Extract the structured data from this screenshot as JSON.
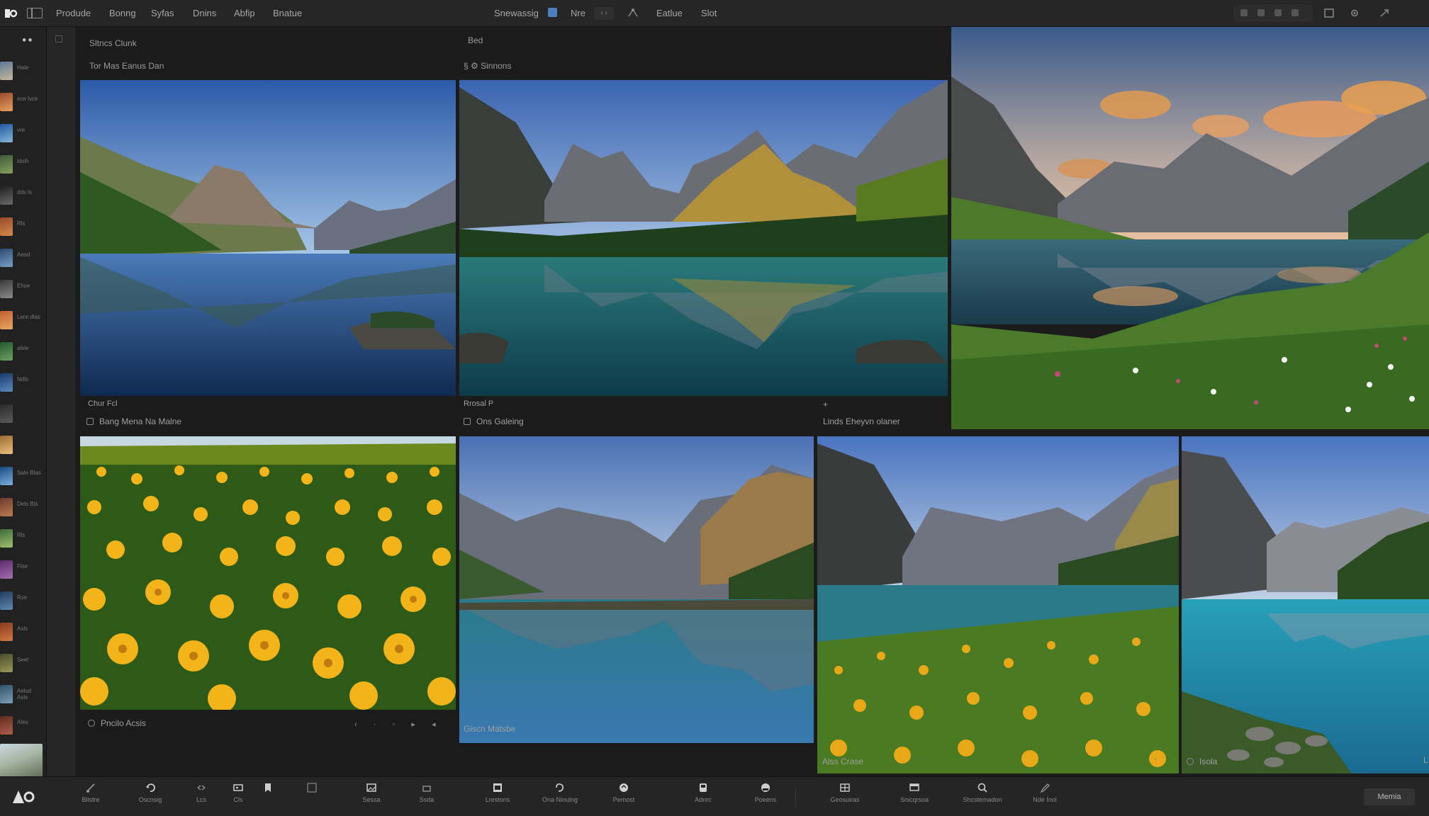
{
  "menubar": {
    "items": [
      "Produde",
      "Bonng",
      "Syfas",
      "Dnins",
      "Abfip",
      "Bnatue"
    ],
    "center": {
      "label_a": "Snewassig",
      "label_b": "Nre",
      "arrows": "‹ ›",
      "label_c": "Eatlue",
      "label_d": "Slot"
    }
  },
  "filmstrip": {
    "header": "⚫⚫",
    "items": [
      {
        "label": "Hale",
        "colors": [
          "#5a7a9a",
          "#c8b89a"
        ]
      },
      {
        "label": "ece lvce",
        "colors": [
          "#9c4a2e",
          "#e8a060"
        ]
      },
      {
        "label": "vre",
        "colors": [
          "#1f5aa0",
          "#86b6d8"
        ]
      },
      {
        "label": "ldsih",
        "colors": [
          "#3c5a3c",
          "#87a05a"
        ]
      },
      {
        "label": "dds ls",
        "colors": [
          "#202020",
          "#6a6a6a"
        ]
      },
      {
        "label": "Rls",
        "colors": [
          "#9a4a2a",
          "#d08a4a"
        ]
      },
      {
        "label": "Aesd",
        "colors": [
          "#2a4a70",
          "#7aa0c8"
        ]
      },
      {
        "label": "Ehse",
        "colors": [
          "#3a3a3a",
          "#8a8a8a"
        ]
      },
      {
        "label": "Lere dlas",
        "colors": [
          "#c06030",
          "#e8a860"
        ]
      },
      {
        "label": "alsle",
        "colors": [
          "#205a30",
          "#70a060"
        ]
      },
      {
        "label": "Ndls",
        "colors": [
          "#1a3a6a",
          "#5a8ac0"
        ]
      },
      {
        "label": "",
        "colors": [
          "#2a2a2a",
          "#5a5a5a"
        ]
      },
      {
        "label": "",
        "colors": [
          "#a06a30",
          "#e8c080"
        ]
      },
      {
        "label": "Sale Blas",
        "colors": [
          "#1a4a80",
          "#7ab0e0"
        ]
      },
      {
        "label": "Dels Bls",
        "colors": [
          "#6a3a2a",
          "#c07a50"
        ]
      },
      {
        "label": "Rls",
        "colors": [
          "#3a6a3a",
          "#a0c070"
        ]
      },
      {
        "label": "Flse",
        "colors": [
          "#5a2a6a",
          "#a070b0"
        ]
      },
      {
        "label": "Rse",
        "colors": [
          "#203a5a",
          "#608ab0"
        ]
      },
      {
        "label": "Asls",
        "colors": [
          "#8a3a20",
          "#d07a40"
        ]
      },
      {
        "label": "Seel",
        "colors": [
          "#4a4a2a",
          "#9a9a5a"
        ]
      },
      {
        "label": "Aelsd Asls",
        "colors": [
          "#30506a",
          "#7aa0b8"
        ]
      },
      {
        "label": "Ales",
        "colors": [
          "#602a20",
          "#b0604a"
        ]
      }
    ]
  },
  "panels": {
    "p1": {
      "header_top": "Sltncs Clunk",
      "header_sub": "Tor Mas Eanus Dan",
      "caption_top": "Chur Fcl",
      "caption": "Bang Mena Na Malne"
    },
    "p2": {
      "header_top": "Bed",
      "header_sub": "Sinnons",
      "caption_top": "Rrosal P",
      "caption": "Ons Galeing"
    },
    "p3": {
      "caption_top": "+",
      "caption": "Linds Eheyvn olaner"
    },
    "p4": {
      "caption": "Pncilo Acsis",
      "tools": "‹ · ◦ ▸ ◂"
    },
    "p5": {
      "caption": "Giscn Matsbe"
    },
    "p6": {
      "caption": "Alss Crase",
      "tools": "◦ ·"
    },
    "p7": {
      "caption": "Isola",
      "edge": "L"
    }
  },
  "bottombar": {
    "tools": [
      {
        "label": "Blistre",
        "icon": "brush-icon"
      },
      {
        "label": "Oscnsig",
        "icon": "rotate-icon"
      },
      {
        "label": "Lcs",
        "icon": "arrows-icon"
      },
      {
        "label": "Cls",
        "icon": "crop-icon"
      },
      {
        "label": "",
        "icon": "bookmark-icon"
      },
      {
        "label": "",
        "icon": "frame-icon"
      },
      {
        "label": "Sessa",
        "icon": "image-icon"
      },
      {
        "label": "Ssda",
        "icon": "layers-icon"
      },
      {
        "label": "Lrestons",
        "icon": "film-icon"
      },
      {
        "label": "Ona Ninulng",
        "icon": "loop-icon"
      },
      {
        "label": "Pemost",
        "icon": "circle-icon"
      },
      {
        "label": "Adnrc",
        "icon": "card-icon"
      },
      {
        "label": "Poeens",
        "icon": "face-icon"
      },
      {
        "label": "Geosuiras",
        "icon": "slides-icon"
      },
      {
        "label": "Snicqrsoa",
        "icon": "panel-icon"
      },
      {
        "label": "Shcstemadon",
        "icon": "search-icon"
      },
      {
        "label": "Nde Inol",
        "icon": "pen-icon"
      }
    ],
    "right_button": "Memia"
  },
  "colors": {
    "background": "#1b1b1b",
    "bar": "#262626",
    "accent_blue": "#4a7fc0"
  }
}
